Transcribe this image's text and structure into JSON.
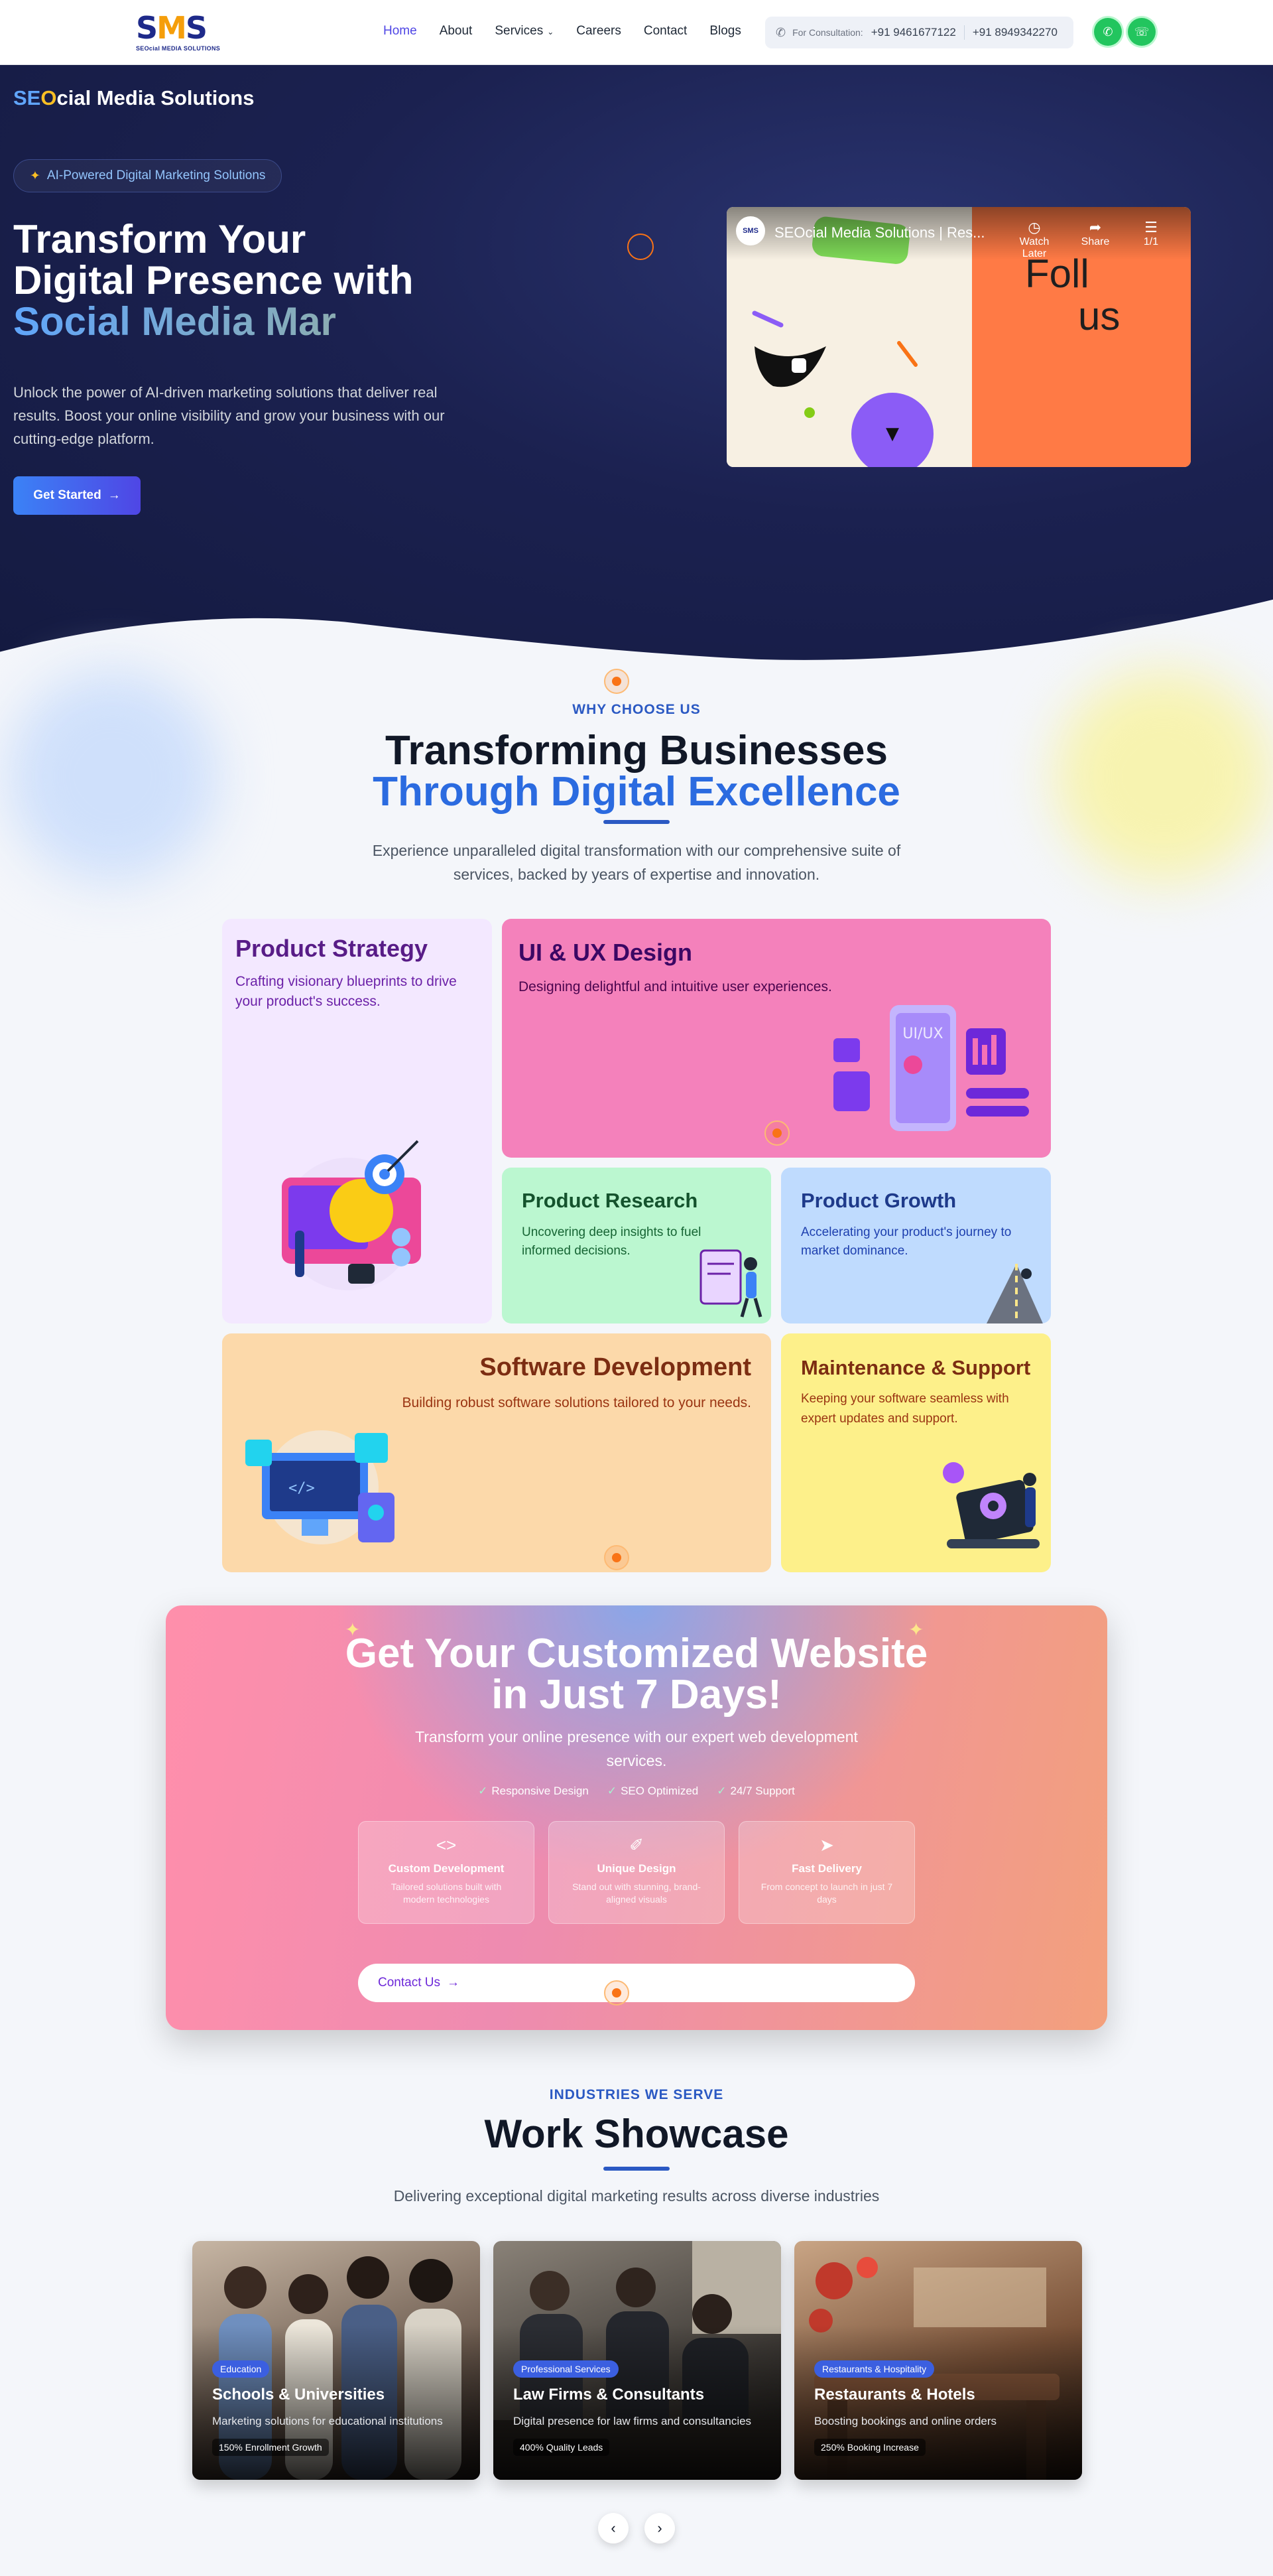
{
  "nav": {
    "logo_text": "SMS",
    "logo_sub": "SEOcial MEDIA SOLUTIONS",
    "items": [
      {
        "label": "Home"
      },
      {
        "label": "About"
      },
      {
        "label": "Services"
      },
      {
        "label": "Careers"
      },
      {
        "label": "Contact"
      },
      {
        "label": "Blogs"
      }
    ],
    "consult_label": "For Consultation:",
    "phone1": "+91 9461677122",
    "phone2": "+91 8949342270"
  },
  "hero": {
    "brand_a": "SE",
    "brand_b": "O",
    "brand_c": "cial Media Solutions",
    "pill": "AI-Powered Digital Marketing Solutions",
    "title_line1": "Transform Your",
    "title_line2": "Digital Presence with",
    "title_line3": "Social Media Mar",
    "description": "Unlock the power of AI-driven marketing solutions that deliver real results. Boost your online visibility and grow your business with our cutting-edge platform.",
    "cta": "Get Started"
  },
  "video": {
    "title": "SEOcial Media Solutions | Res...",
    "watch_later": "Watch Later",
    "share": "Share",
    "playlist": "1/1",
    "overlay_1": "Foll",
    "overlay_2": "us"
  },
  "why": {
    "eyebrow": "WHY CHOOSE US",
    "title_line1": "Transforming Businesses",
    "title_line2": "Through Digital Excellence",
    "subtitle": "Experience unparalleled digital transformation with our comprehensive suite of services, backed by years of expertise and innovation."
  },
  "services": [
    {
      "title": "Product Strategy",
      "description": "Crafting visionary blueprints to drive your product's success."
    },
    {
      "title": "UI & UX Design",
      "description": "Designing delightful and intuitive user experiences."
    },
    {
      "title": "Product Research",
      "description": "Uncovering deep insights to fuel informed decisions."
    },
    {
      "title": "Product Growth",
      "description": "Accelerating your product's journey to market dominance."
    },
    {
      "title": "Software Development",
      "description": "Building robust software solutions tailored to your needs."
    },
    {
      "title": "Maintenance & Support",
      "description": "Keeping your software seamless with expert updates and support."
    }
  ],
  "promo": {
    "title_line1": "Get Your Customized Website",
    "title_line2": "in Just 7 Days!",
    "subtitle": "Transform your online presence with our expert web development services.",
    "chips": [
      "Responsive Design",
      "SEO Optimized",
      "24/7 Support"
    ],
    "features": [
      {
        "name": "Custom Development",
        "description": "Tailored solutions built with modern technologies"
      },
      {
        "name": "Unique Design",
        "description": "Stand out with stunning, brand-aligned visuals"
      },
      {
        "name": "Fast Delivery",
        "description": "From concept to launch in just 7 days"
      }
    ],
    "contact": "Contact Us"
  },
  "showcase": {
    "eyebrow": "INDUSTRIES WE SERVE",
    "title": "Work Showcase",
    "subtitle": "Delivering exceptional digital marketing results across diverse industries",
    "items": [
      {
        "tag": "Education",
        "title": "Schools & Universities",
        "description": "Marketing solutions for educational institutions",
        "stat": "150% Enrollment Growth"
      },
      {
        "tag": "Professional Services",
        "title": "Law Firms & Consultants",
        "description": "Digital presence for law firms and consultancies",
        "stat": "400% Quality Leads"
      },
      {
        "tag": "Restaurants & Hospitality",
        "title": "Restaurants & Hotels",
        "description": "Boosting bookings and online orders",
        "stat": "250% Booking Increase"
      }
    ]
  }
}
